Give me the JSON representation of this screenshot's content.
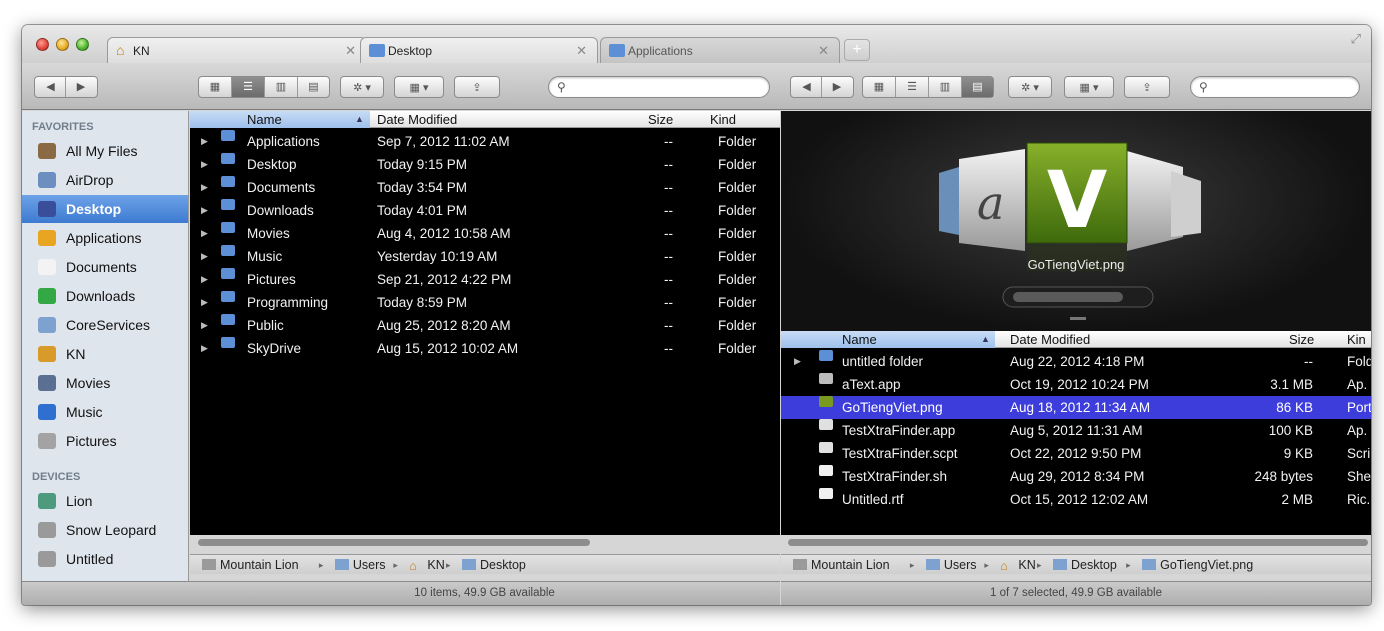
{
  "window": {
    "tabs": [
      {
        "label": "KN",
        "icon": "home-icon"
      },
      {
        "label": "Desktop",
        "icon": "folder-icon"
      },
      {
        "label": "Applications",
        "icon": "folder-icon"
      }
    ],
    "close_glyph": "✕",
    "add_tab_glyph": "+"
  },
  "toolbar": {
    "back_glyph": "◀",
    "forward_glyph": "▶",
    "view_icon_glyph": "▦",
    "view_list_glyph": "☰",
    "view_column_glyph": "▥",
    "view_flow_glyph": "▤",
    "action_glyph": "✲ ▾",
    "arrange_glyph": "▦ ▾",
    "share_glyph": "⇪",
    "search_glyph": "⚲",
    "search_placeholder": ""
  },
  "sidebar": {
    "favorites_header": "FAVORITES",
    "devices_header": "DEVICES",
    "favorites": [
      {
        "label": "All My Files",
        "color": "#8a6a44"
      },
      {
        "label": "AirDrop",
        "color": "#6c8fbf"
      },
      {
        "label": "Desktop",
        "color": "#3a4d9b",
        "selected": true
      },
      {
        "label": "Applications",
        "color": "#e8a521"
      },
      {
        "label": "Documents",
        "color": "#f3f3f3"
      },
      {
        "label": "Downloads",
        "color": "#34a844"
      },
      {
        "label": "CoreServices",
        "color": "#7ea2cf"
      },
      {
        "label": "KN",
        "color": "#d89b2a"
      },
      {
        "label": "Movies",
        "color": "#5b6f93"
      },
      {
        "label": "Music",
        "color": "#2f6fd0"
      },
      {
        "label": "Pictures",
        "color": "#a3a3a3"
      }
    ],
    "devices": [
      {
        "label": "Lion",
        "color": "#4d9a7e"
      },
      {
        "label": "Snow Leopard",
        "color": "#9a9a9a"
      },
      {
        "label": "Untitled",
        "color": "#9a9a9a"
      }
    ]
  },
  "left_pane": {
    "columns": {
      "name": "Name",
      "date": "Date Modified",
      "size": "Size",
      "kind": "Kind"
    },
    "rows": [
      {
        "name": "Applications",
        "date": "Sep 7, 2012 11:02 AM",
        "size": "--",
        "kind": "Folder"
      },
      {
        "name": "Desktop",
        "date": "Today 9:15 PM",
        "size": "--",
        "kind": "Folder"
      },
      {
        "name": "Documents",
        "date": "Today 3:54 PM",
        "size": "--",
        "kind": "Folder"
      },
      {
        "name": "Downloads",
        "date": "Today 4:01 PM",
        "size": "--",
        "kind": "Folder"
      },
      {
        "name": "Movies",
        "date": "Aug 4, 2012 10:58 AM",
        "size": "--",
        "kind": "Folder"
      },
      {
        "name": "Music",
        "date": "Yesterday 10:19 AM",
        "size": "--",
        "kind": "Folder"
      },
      {
        "name": "Pictures",
        "date": "Sep 21, 2012 4:22 PM",
        "size": "--",
        "kind": "Folder"
      },
      {
        "name": "Programming",
        "date": "Today 8:59 PM",
        "size": "--",
        "kind": "Folder"
      },
      {
        "name": "Public",
        "date": "Aug 25, 2012 8:20 AM",
        "size": "--",
        "kind": "Folder"
      },
      {
        "name": "SkyDrive",
        "date": "Aug 15, 2012 10:02 AM",
        "size": "--",
        "kind": "Folder"
      }
    ],
    "path": [
      "Mountain Lion",
      "Users",
      "KN",
      "Desktop"
    ],
    "status": "10 items, 49.9 GB available"
  },
  "right_pane": {
    "preview": {
      "title": "GoTiengViet.png",
      "letter": "V",
      "script_letter": "a"
    },
    "columns": {
      "name": "Name",
      "date": "Date Modified",
      "size": "Size",
      "kind": "Kin"
    },
    "rows": [
      {
        "name": "untitled folder",
        "date": "Aug 22, 2012 4:18 PM",
        "size": "--",
        "kind": "Fold",
        "icon_color": "#5d8fd6",
        "disclosure": "▶"
      },
      {
        "name": "aText.app",
        "date": "Oct 19, 2012 10:24 PM",
        "size": "3.1 MB",
        "kind": "Ap.",
        "icon_color": "#bdbdbd"
      },
      {
        "name": "GoTiengViet.png",
        "date": "Aug 18, 2012 11:34 AM",
        "size": "86 KB",
        "kind": "Port",
        "icon_color": "#7a9a1f",
        "selected": true
      },
      {
        "name": "TestXtraFinder.app",
        "date": "Aug 5, 2012 11:31 AM",
        "size": "100 KB",
        "kind": "Ap.",
        "icon_color": "#e0e0e0"
      },
      {
        "name": "TestXtraFinder.scpt",
        "date": "Oct 22, 2012 9:50 PM",
        "size": "9 KB",
        "kind": "Scri",
        "icon_color": "#e0e0e0"
      },
      {
        "name": "TestXtraFinder.sh",
        "date": "Aug 29, 2012 8:34 PM",
        "size": "248 bytes",
        "kind": "She",
        "icon_color": "#f0f0f0"
      },
      {
        "name": "Untitled.rtf",
        "date": "Oct 15, 2012 12:02 AM",
        "size": "2 MB",
        "kind": "Ric.",
        "icon_color": "#f0f0f0"
      }
    ],
    "path": [
      "Mountain Lion",
      "Users",
      "KN",
      "Desktop",
      "GoTiengViet.png"
    ],
    "status": "1 of 7 selected, 49.9 GB available"
  },
  "colors": {
    "selection": "#3d3ddb",
    "sidebar_selected": "#3d7bd1",
    "list_bg": "#000000",
    "sidebar_bg": "#dfe5ed"
  }
}
